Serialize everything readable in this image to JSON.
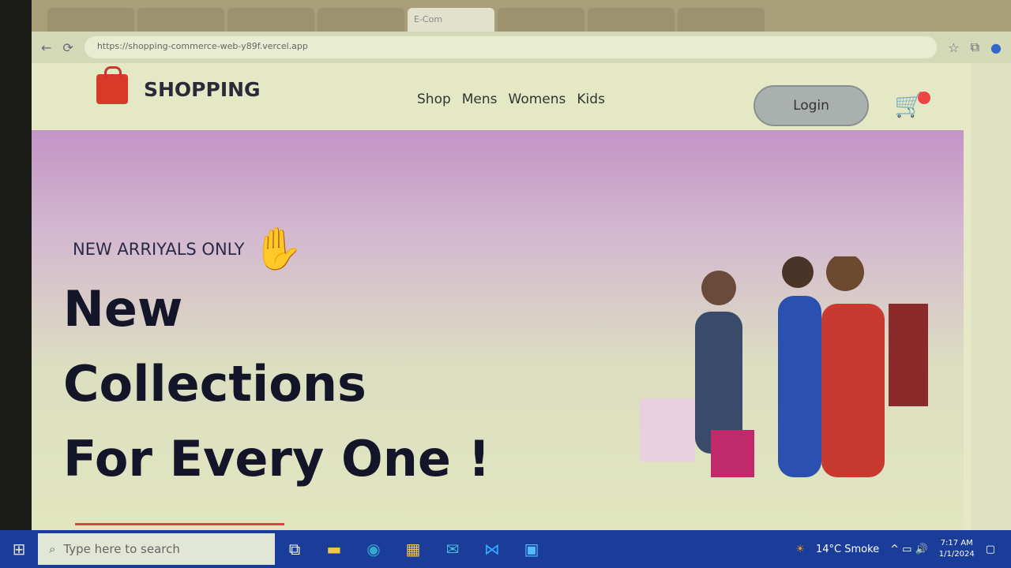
{
  "browser": {
    "active_tab": "E-Com",
    "url": "https://shopping-commerce-web-y89f.vercel.app"
  },
  "nav": {
    "brand": "SHOPPING",
    "links": [
      "Shop",
      "Mens",
      "Womens",
      "Kids"
    ],
    "login": "Login"
  },
  "hero": {
    "tagline": "NEW ARRIYALS ONLY",
    "line1": "New",
    "line2": "Collections",
    "line3": "For Every One !"
  },
  "taskbar": {
    "search_placeholder": "Type here to search",
    "weather": "14°C Smoke",
    "time": "7:17 AM",
    "date": "1/1/2024"
  }
}
